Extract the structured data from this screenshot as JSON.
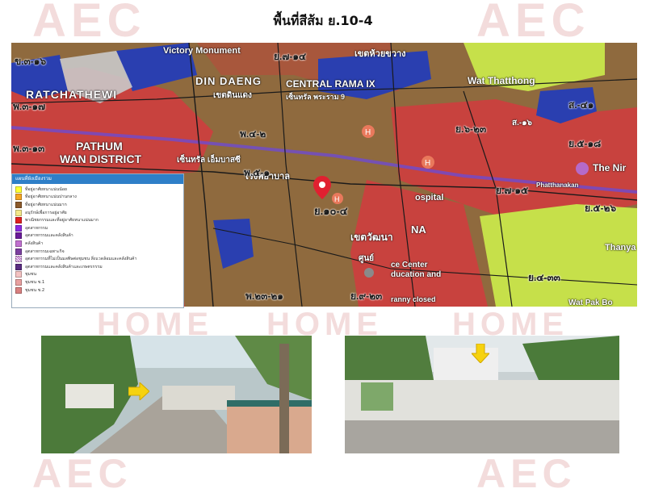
{
  "title": "พื้นที่สีส้ม ย.10-4",
  "watermark": {
    "brand": "AEC",
    "subtitle": "HOME"
  },
  "legend": {
    "header": "แผนที่ผังเมืองรวม",
    "items": [
      {
        "label": "ที่อยู่อาศัยหนาแน่นน้อย",
        "color": "#ffff33"
      },
      {
        "label": "ที่อยู่อาศัยหนาแน่นปานกลาง",
        "color": "#f5a623"
      },
      {
        "label": "ที่อยู่อาศัยหนาแน่นมาก",
        "color": "#8b5a2b"
      },
      {
        "label": "อนุรักษ์เพื่อการอยู่อาศัย",
        "color": "#f3e88a"
      },
      {
        "label": "พาณิชยกรรมและที่อยู่อาศัยหนาแน่นมาก",
        "color": "#e02020"
      },
      {
        "label": "อุตสาหกรรม",
        "color": "#8a2be2"
      },
      {
        "label": "อุตสาหกรรมและคลังสินค้า",
        "color": "#6a1b9a"
      },
      {
        "label": "คลังสินค้า",
        "color": "#c070d0"
      },
      {
        "label": "อุตสาหกรรมเฉพาะกิจ",
        "color": "#7b3fa0"
      },
      {
        "label": "อุตสาหกรรมที่ไม่เป็นมลพิษต่อชุมชน สิ่งแวดล้อมและคลังสินค้า",
        "color": "#b05cc0"
      },
      {
        "label": "อุตสาหกรรมและคลังสินค้าและเกษตรกรรม",
        "color": "#5a2d82"
      },
      {
        "label": "ชุมชน",
        "color": "#f4c2c2"
      },
      {
        "label": "ชุมชน ช.1",
        "color": "#e8a0a0"
      },
      {
        "label": "ชุมชน ช.2",
        "color": "#d98080"
      }
    ]
  },
  "map": {
    "colors": {
      "commercial": "#c8423e",
      "residential_high": "#8f6a3e",
      "government": "#2a3fb0",
      "low_density": "#c6e04a",
      "road": "#1a1a1a"
    },
    "zone_labels": [
      "ข.๓-๑๖",
      "ย.๗-๑๔",
      "พ.๓-๑๗",
      "ย.๖-๒๓",
      "พ.๓-๑๓",
      "พ.๔-๒",
      "พ.๕-๑",
      "ย.๑๐-๔",
      "ย.๗-๑๕",
      "ย.๕-๒๖",
      "ย.๕-๑๘",
      "ส.-๔๑",
      "ย.๔-๓๓",
      "พ.๒๓-๒๑",
      "ย.๙-๒๓"
    ],
    "place_labels": [
      "Victory Monument",
      "DIN DAENG",
      "เขตดินแดง",
      "CENTRAL RAMA IX",
      "เซ็นทรัล พระราม 9",
      "RATCHATHEWI",
      "PATHUM",
      "WAN DISTRICT",
      "เซ็นทรัล เอ็มบาสซี",
      "Wat Thatthong",
      "โรงพยาบาล",
      "The Nir",
      "Thanya",
      "Wat Pak Bo",
      "Phatthanakan",
      "เขตวัฒนา",
      "NA",
      "ospital",
      "ce Center",
      "ducation and",
      "ranny closed",
      "เขตห้วยขวาง",
      "ส.-๑๖",
      "ศูนย์"
    ]
  },
  "photos": [
    {
      "caption": "",
      "description_icon": "arrow-right-icon"
    },
    {
      "caption": "",
      "description_icon": "arrow-down-icon"
    }
  ]
}
